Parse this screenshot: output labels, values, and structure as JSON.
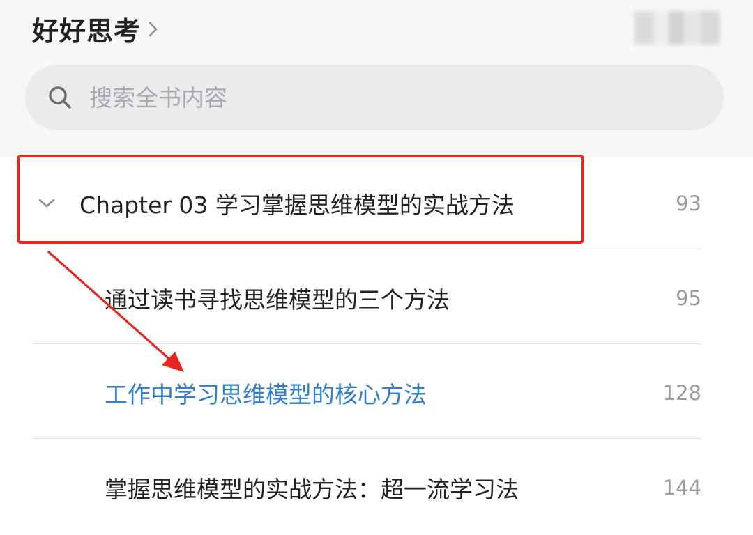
{
  "header": {
    "book_title": "好好思考"
  },
  "search": {
    "placeholder": "搜索全书内容"
  },
  "toc": {
    "chapter": {
      "label": "Chapter 03 学习掌握思维模型的实战方法",
      "page": "93"
    },
    "sections": [
      {
        "label": "通过读书寻找思维模型的三个方法",
        "page": "95"
      },
      {
        "label": "工作中学习思维模型的核心方法",
        "page": "128",
        "active": true
      },
      {
        "label": "掌握思维模型的实战方法：超一流学习法",
        "page": "144"
      }
    ]
  },
  "colors": {
    "accent_blue": "#2f7fd1",
    "annotation_red": "#e8261f",
    "header_bg": "#f7f7f8",
    "search_bg": "#ebebed"
  },
  "icons": {
    "title_chevron": "chevron-right-icon",
    "search": "search-icon",
    "chapter_toggle": "chevron-down-icon"
  }
}
